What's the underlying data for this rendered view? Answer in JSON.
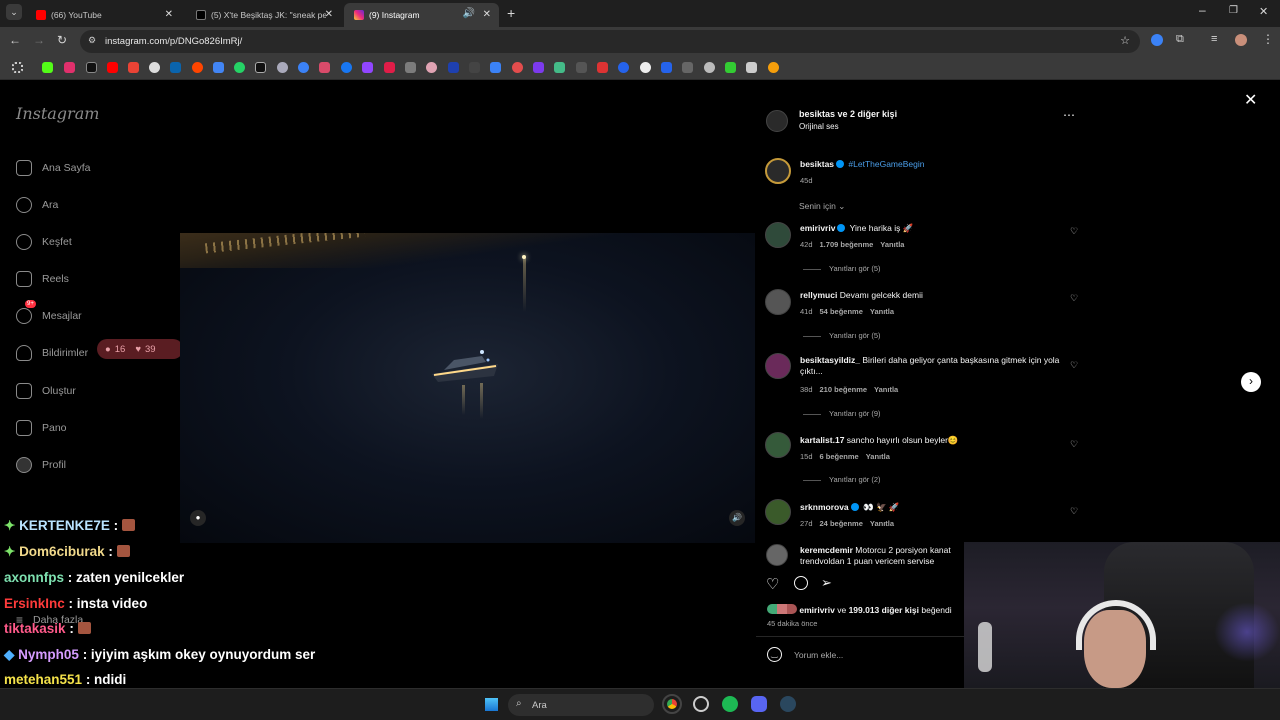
{
  "browser": {
    "tabs": [
      {
        "title": "(66) YouTube",
        "color": "#ff0000"
      },
      {
        "title": "(5) X'te Beşiktaş JK: \"sneak peek\"",
        "color": "#000000"
      },
      {
        "title": "(9) Instagram",
        "color": "#e1306c"
      }
    ],
    "url": "instagram.com/p/DNGo826ImRj/"
  },
  "ig": {
    "logo": "Instagram",
    "nav": [
      {
        "label": "Ana Sayfa",
        "icon": "home-icon"
      },
      {
        "label": "Ara",
        "icon": "search-icon"
      },
      {
        "label": "Keşfet",
        "icon": "compass-icon"
      },
      {
        "label": "Reels",
        "icon": "reels-icon"
      },
      {
        "label": "Mesajlar",
        "icon": "messenger-icon",
        "badge": "9+"
      },
      {
        "label": "Bildirimler",
        "icon": "heart-icon"
      },
      {
        "label": "Oluştur",
        "icon": "plus-square-icon"
      },
      {
        "label": "Pano",
        "icon": "chart-icon"
      },
      {
        "label": "Profil",
        "icon": "avatar-icon"
      }
    ],
    "more": "Daha fazla",
    "notif_popup": {
      "comments": "16",
      "likes": "39"
    },
    "post": {
      "header_user": "besiktas",
      "header_rest": " ve 2 diğer kişi",
      "audio": "Orijinal ses",
      "caption_user": "besiktas",
      "caption_tag": "#LetTheGameBegin",
      "caption_age": "45d",
      "sort": "Senin için"
    },
    "comments": [
      {
        "user": "emirivriv",
        "verified": true,
        "text": "Yine harika iş 🚀",
        "age": "42d",
        "likes": "1.709 beğenme",
        "reply": "Yanıtla",
        "replies": "Yanıtları gör (5)"
      },
      {
        "user": "rellymuci",
        "verified": false,
        "text": "Devamı gelcekk demii",
        "age": "41d",
        "likes": "54 beğenme",
        "reply": "Yanıtla",
        "replies": "Yanıtları gör (5)"
      },
      {
        "user": "besiktasyildiz_",
        "verified": false,
        "text": "Birileri daha geliyor çanta başkasına gitmek için yola çıktı...",
        "age": "38d",
        "likes": "210 beğenme",
        "reply": "Yanıtla",
        "replies": "Yanıtları gör (9)"
      },
      {
        "user": "kartalist.17",
        "verified": false,
        "text": "sancho hayırlı olsun beyler😊",
        "age": "15d",
        "likes": "6 beğenme",
        "reply": "Yanıtla",
        "replies": "Yanıtları gör (2)"
      },
      {
        "user": "srknmorova",
        "verified": true,
        "text": "👀 🦅 🚀",
        "age": "27d",
        "likes": "24 beğenme",
        "reply": "Yanıtla",
        "replies": ""
      },
      {
        "user": "keremcdemir",
        "verified": false,
        "text": "Motorcu 2 porsiyon kanat trendvoldan 1 puan vericem servise",
        "age": "",
        "likes": "",
        "reply": "",
        "replies": ""
      }
    ],
    "liked_by_user": "emirivriv",
    "liked_by_rest": "199.013 diğer kişi",
    "liked_by_suffix": "beğendi",
    "liked_by_and": "ve",
    "posted_ago": "45 dakika önce",
    "comment_placeholder": "Yorum ekle..."
  },
  "chat": [
    {
      "user": "KERTENKE7E",
      "color": "#b9e3ff",
      "text": ":",
      "badge": true,
      "emote": true
    },
    {
      "user": "Dom6ciburak",
      "color": "#f1d98b",
      "text": ":",
      "badge": true,
      "emote": true
    },
    {
      "user": "axonnfps",
      "color": "#7ee1b0",
      "text": ": zaten yenilcekler",
      "badge": false,
      "emote": false
    },
    {
      "user": "ErsinkInc",
      "color": "#ff3b3b",
      "text": ": insta video",
      "badge": false,
      "emote": false
    },
    {
      "user": "tiktakasik",
      "color": "#ff5a8a",
      "text": ":",
      "badge": false,
      "emote": true
    },
    {
      "user": "Nymph05",
      "color": "#d59cff",
      "text": ": iyiyim aşkım okey oynuyordum ser",
      "badge": true,
      "emote": false
    },
    {
      "user": "metehan551",
      "color": "#f4e24a",
      "text": ": ndidi",
      "badge": false,
      "emote": false
    }
  ],
  "taskbar": {
    "search": "Ara"
  }
}
